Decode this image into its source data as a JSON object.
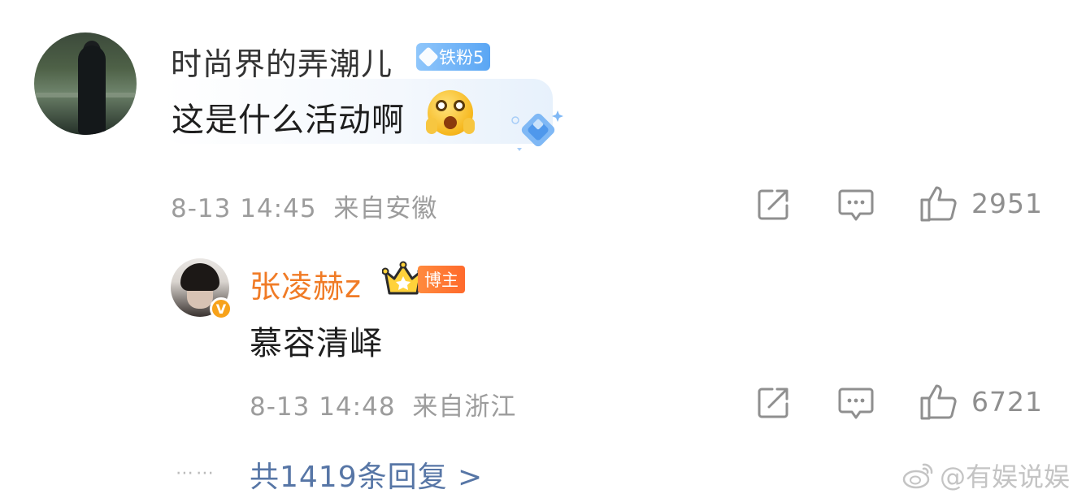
{
  "comment": {
    "username": "时尚界的弄潮儿",
    "fan_badge": "铁粉5",
    "text": "这是什么活动啊",
    "emoji": "shocked-emoji",
    "date": "8-13 14:45",
    "location": "来自安徽",
    "like_count": "2951"
  },
  "reply": {
    "username": "张凌赫z",
    "badge": "博主",
    "text": "慕容清峄",
    "date": "8-13 14:48",
    "location": "来自浙江",
    "like_count": "6721"
  },
  "footer": {
    "dots": "⋯⋯",
    "more_replies": "共1419条回复 >",
    "watermark": "@有娱说娱"
  },
  "icons": {
    "share": "share-icon",
    "comment": "comment-icon",
    "like": "thumbs-up-icon",
    "verified": "verified-v-icon",
    "crown": "crown-icon",
    "diamond": "diamond-icon",
    "weibo": "weibo-logo-icon"
  },
  "colors": {
    "reply_name": "#f07b26",
    "link": "#5776a6",
    "meta": "#9c9c9c",
    "fan_badge": "#6fb3f7",
    "blogger_badge": "#ff7a33"
  }
}
